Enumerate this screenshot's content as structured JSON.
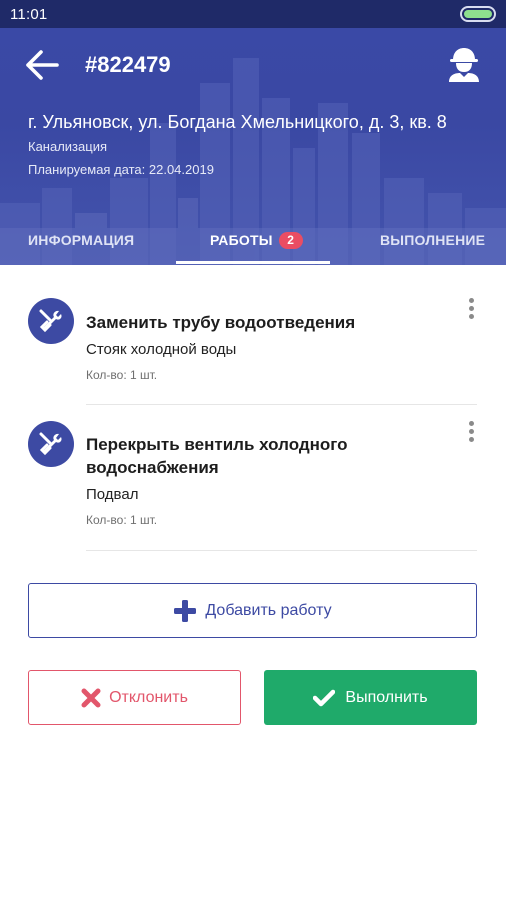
{
  "status_bar": {
    "time": "11:01",
    "battery_level": 1.0
  },
  "header": {
    "order_number": "#822479",
    "address": "г. Ульяновск, ул. Богдана Хмельницкого, д. 3, кв. 8",
    "category": "Канализация",
    "planned_date": "Планируемая дата: 22.04.2019",
    "icons": {
      "back": "arrow-left-icon",
      "worker": "worker-helmet-icon"
    }
  },
  "tabs": [
    {
      "label": "ИНФОРМАЦИЯ"
    },
    {
      "label": "РАБОТЫ",
      "badge": "2",
      "active": true
    },
    {
      "label": "ВЫПОЛНЕНИЕ"
    }
  ],
  "works": [
    {
      "title": "Заменить трубу водоотведения",
      "place": "Стояк холодной воды",
      "quantity": "Кол-во: 1 шт.",
      "icon": "tools-icon"
    },
    {
      "title_line1": "Перекрыть вентиль холодного",
      "title_line2": "водоснабжения",
      "place": "Подвал",
      "quantity": "Кол-во: 1 шт.",
      "icon": "tools-icon"
    }
  ],
  "actions": {
    "add_work": "Добавить работу",
    "reject": "Отклонить",
    "complete": "Выполнить"
  },
  "colors": {
    "header": "#3a49a6",
    "primary": "#3d4aa3",
    "badge": "#ea4d63",
    "reject": "#e2566b",
    "complete": "#1faa6a"
  }
}
